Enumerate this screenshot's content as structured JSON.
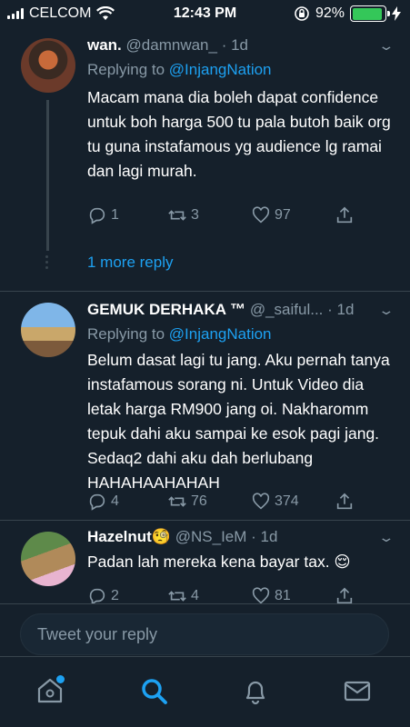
{
  "status_bar": {
    "carrier": "CELCOM",
    "time": "12:43 PM",
    "battery_percent": "92%",
    "battery_level": 0.92,
    "battery_color": "#34c759"
  },
  "tweets": [
    {
      "name": "wan.",
      "handle": "@damnwan_",
      "age": "· 1d",
      "replying_prefix": "Replying to",
      "mention": "@InjangNation",
      "text": "Macam mana dia boleh dapat confidence untuk boh harga 500 tu pala butoh baik org tu guna instafamous yg audience lg ramai dan lagi murah.",
      "replies": "1",
      "retweets": "3",
      "likes": "97"
    },
    {
      "name": "GEMUK DERHAKA ™",
      "handle": "@_saiful...",
      "age": "· 1d",
      "replying_prefix": "Replying to",
      "mention": "@InjangNation",
      "text": "Belum dasat lagi tu jang. Aku pernah tanya instafamous sorang ni. Untuk Video dia letak harga RM900 jang oi. Nakharomm tepuk dahi aku sampai ke esok pagi jang. Sedaq2 dahi aku dah berlubang HAHAHAAHAHAH",
      "replies": "4",
      "retweets": "76",
      "likes": "374"
    },
    {
      "name": "Hazelnut",
      "name_emoji": "🧐",
      "handle": "@NS_IeM",
      "age": "· 1d",
      "text": "Padan lah mereka kena bayar tax. 😌",
      "replies": "2",
      "retweets": "4",
      "likes": "81"
    }
  ],
  "more_replies_label": "1 more reply",
  "composer": {
    "placeholder": "Tweet your reply"
  },
  "tabs": [
    "home",
    "search",
    "notifications",
    "messages"
  ],
  "colors": {
    "background": "#15202b",
    "accent": "#1da1f2",
    "muted": "#8899a6",
    "border": "#38444d"
  }
}
